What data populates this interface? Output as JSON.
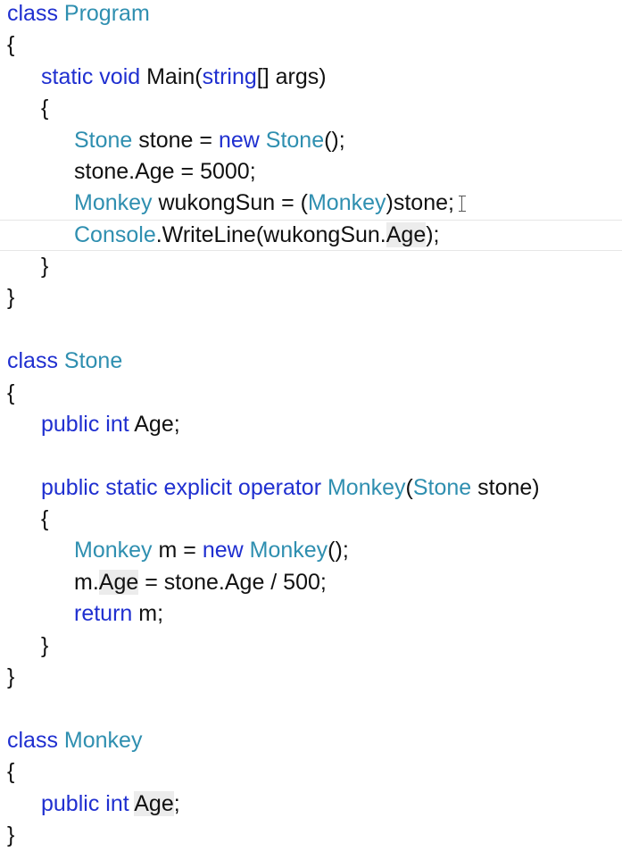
{
  "editor": {
    "language": "C#",
    "colors": {
      "keyword": "#1f2fd0",
      "type": "#2f8fb0",
      "text": "#111111",
      "reference_highlight": "#ececec",
      "current_line_border": "#e6e6e6"
    },
    "current_line_index": 7,
    "mouse_cursor": "text-ibeam-icon",
    "lines": [
      {
        "indent": 0,
        "tokens": [
          {
            "t": "class ",
            "k": "keyword"
          },
          {
            "t": "Program",
            "k": "type"
          }
        ]
      },
      {
        "indent": 0,
        "tokens": [
          {
            "t": "{",
            "k": "plain"
          }
        ]
      },
      {
        "indent": 1,
        "tokens": [
          {
            "t": "static void ",
            "k": "keyword"
          },
          {
            "t": "Main(",
            "k": "plain"
          },
          {
            "t": "string",
            "k": "keyword"
          },
          {
            "t": "[] args)",
            "k": "plain"
          }
        ]
      },
      {
        "indent": 1,
        "tokens": [
          {
            "t": "{",
            "k": "plain"
          }
        ]
      },
      {
        "indent": 2,
        "tokens": [
          {
            "t": "Stone",
            "k": "type"
          },
          {
            "t": " stone = ",
            "k": "plain"
          },
          {
            "t": "new ",
            "k": "keyword"
          },
          {
            "t": "Stone",
            "k": "type"
          },
          {
            "t": "();",
            "k": "plain"
          }
        ]
      },
      {
        "indent": 2,
        "tokens": [
          {
            "t": "stone.Age = 5000;",
            "k": "plain"
          }
        ]
      },
      {
        "indent": 2,
        "tokens": [
          {
            "t": "Monkey",
            "k": "type"
          },
          {
            "t": " wukongSun = (",
            "k": "plain"
          },
          {
            "t": "Monkey",
            "k": "type"
          },
          {
            "t": ")stone;",
            "k": "plain"
          }
        ]
      },
      {
        "indent": 2,
        "tokens": [
          {
            "t": "Console",
            "k": "type"
          },
          {
            "t": ".WriteLine(wukongSun.",
            "k": "plain"
          },
          {
            "t": "Age",
            "k": "plain",
            "hl": true
          },
          {
            "t": ");",
            "k": "plain"
          }
        ]
      },
      {
        "indent": 1,
        "tokens": [
          {
            "t": "}",
            "k": "plain"
          }
        ]
      },
      {
        "indent": 0,
        "tokens": [
          {
            "t": "}",
            "k": "plain"
          }
        ]
      },
      {
        "indent": 0,
        "tokens": []
      },
      {
        "indent": 0,
        "tokens": [
          {
            "t": "class ",
            "k": "keyword"
          },
          {
            "t": "Stone",
            "k": "type"
          }
        ]
      },
      {
        "indent": 0,
        "tokens": [
          {
            "t": "{",
            "k": "plain"
          }
        ]
      },
      {
        "indent": 1,
        "tokens": [
          {
            "t": "public int ",
            "k": "keyword"
          },
          {
            "t": "Age;",
            "k": "plain"
          }
        ]
      },
      {
        "indent": 0,
        "tokens": []
      },
      {
        "indent": 1,
        "tokens": [
          {
            "t": "public static explicit operator ",
            "k": "keyword"
          },
          {
            "t": "Monkey",
            "k": "type"
          },
          {
            "t": "(",
            "k": "plain"
          },
          {
            "t": "Stone",
            "k": "type"
          },
          {
            "t": " stone)",
            "k": "plain"
          }
        ]
      },
      {
        "indent": 1,
        "tokens": [
          {
            "t": "{",
            "k": "plain"
          }
        ]
      },
      {
        "indent": 2,
        "tokens": [
          {
            "t": "Monkey",
            "k": "type"
          },
          {
            "t": " m = ",
            "k": "plain"
          },
          {
            "t": "new ",
            "k": "keyword"
          },
          {
            "t": "Monkey",
            "k": "type"
          },
          {
            "t": "();",
            "k": "plain"
          }
        ]
      },
      {
        "indent": 2,
        "tokens": [
          {
            "t": "m.",
            "k": "plain"
          },
          {
            "t": "Age",
            "k": "plain",
            "hl": true
          },
          {
            "t": " = stone.Age / 500;",
            "k": "plain"
          }
        ]
      },
      {
        "indent": 2,
        "tokens": [
          {
            "t": "return ",
            "k": "keyword"
          },
          {
            "t": "m;",
            "k": "plain"
          }
        ]
      },
      {
        "indent": 1,
        "tokens": [
          {
            "t": "}",
            "k": "plain"
          }
        ]
      },
      {
        "indent": 0,
        "tokens": [
          {
            "t": "}",
            "k": "plain"
          }
        ]
      },
      {
        "indent": 0,
        "tokens": []
      },
      {
        "indent": 0,
        "tokens": [
          {
            "t": "class ",
            "k": "keyword"
          },
          {
            "t": "Monkey",
            "k": "type"
          }
        ]
      },
      {
        "indent": 0,
        "tokens": [
          {
            "t": "{",
            "k": "plain"
          }
        ]
      },
      {
        "indent": 1,
        "tokens": [
          {
            "t": "public int ",
            "k": "keyword"
          },
          {
            "t": "Age",
            "k": "plain",
            "hl": true
          },
          {
            "t": ";",
            "k": "plain"
          }
        ]
      },
      {
        "indent": 0,
        "tokens": [
          {
            "t": "}",
            "k": "plain"
          }
        ]
      }
    ]
  }
}
